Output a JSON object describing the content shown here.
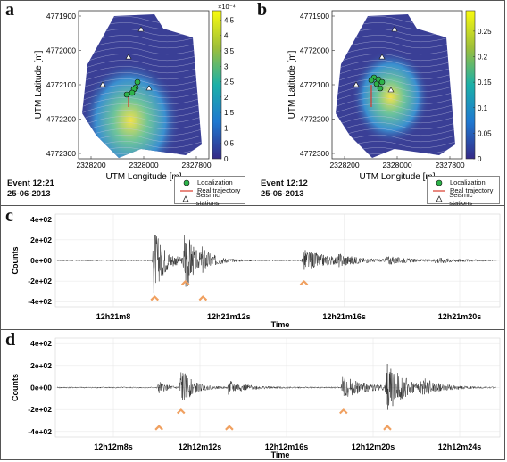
{
  "panels": [
    {
      "letter": "a",
      "event_line1": "Event 12:21",
      "event_line2": "25-06-2013",
      "y_ticks": [
        "4771900",
        "4772000",
        "4772100",
        "4772200",
        "4772300"
      ],
      "x_ticks": [
        "2328200",
        "2328000",
        "2327800"
      ],
      "ylabel": "UTM Latitude [m]",
      "xlabel": "UTM Longitude [m]",
      "colorbar": {
        "exponent": "×10⁻⁴",
        "ticks": [
          "4.5",
          "4",
          "3.5",
          "3",
          "2.5",
          "2",
          "1.5",
          "1",
          "0.5",
          "0"
        ],
        "max": 4.8
      },
      "legend": [
        "Localization",
        "Real trajectory",
        "Seismic stations"
      ]
    },
    {
      "letter": "b",
      "event_line1": "Event 12:12",
      "event_line2": "25-06-2013",
      "y_ticks": [
        "4771900",
        "4772000",
        "4772100",
        "4772200",
        "4772300"
      ],
      "x_ticks": [
        "2328200",
        "2328000",
        "2327800"
      ],
      "ylabel": "UTM Latitude [m]",
      "xlabel": "UTM Longitude [m]",
      "colorbar": {
        "exponent": "",
        "ticks": [
          "0.25",
          "0.2",
          "0.15",
          "0.1",
          "0.05",
          "0"
        ],
        "max": 0.29
      },
      "legend": [
        "Localization",
        "Real trajectory",
        "Seismic stations"
      ]
    }
  ],
  "chart_data": [
    {
      "type": "line",
      "panel": "c",
      "ylabel": "Counts",
      "xlabel": "Time",
      "y_ticks": [
        "4e+02",
        "2e+02",
        "0e+00",
        "-2e+02",
        "-4e+02"
      ],
      "x_ticks": [
        "12h21m8",
        "12h21m12s",
        "12h21m16s",
        "12h21m20s"
      ],
      "arrows": 4,
      "bursts": [
        {
          "center": 0.22,
          "amp": 330,
          "width": 0.025
        },
        {
          "center": 0.29,
          "amp": 360,
          "width": 0.02
        },
        {
          "center": 0.33,
          "amp": 90,
          "width": 0.03
        },
        {
          "center": 0.56,
          "amp": 110,
          "width": 0.06
        },
        {
          "center": 0.64,
          "amp": 40,
          "width": 0.04
        },
        {
          "center": 0.75,
          "amp": 35,
          "width": 0.05
        },
        {
          "center": 0.86,
          "amp": 25,
          "width": 0.05
        }
      ]
    },
    {
      "type": "line",
      "panel": "d",
      "ylabel": "Counts",
      "xlabel": "Time",
      "y_ticks": [
        "4e+02",
        "2e+02",
        "0e+00",
        "-2e+02",
        "-4e+02"
      ],
      "x_ticks": [
        "12h12m8s",
        "12h12m12s",
        "12h12m16s",
        "12h12m20s",
        "12h12m24s"
      ],
      "arrows": 5,
      "bursts": [
        {
          "center": 0.23,
          "amp": 60,
          "width": 0.02
        },
        {
          "center": 0.28,
          "amp": 190,
          "width": 0.025
        },
        {
          "center": 0.39,
          "amp": 60,
          "width": 0.04
        },
        {
          "center": 0.65,
          "amp": 110,
          "width": 0.05
        },
        {
          "center": 0.75,
          "amp": 230,
          "width": 0.04
        },
        {
          "center": 0.83,
          "amp": 60,
          "width": 0.04
        }
      ]
    }
  ],
  "colors": {
    "map_bg": "#3a3f96",
    "contour": "#c8cbe6",
    "hot": "#f2e24a",
    "warm": "#6ec49a",
    "marker_green": "#2db34a",
    "trajectory": "#d83a2a",
    "arrow": "#f0a060",
    "trace": "#222222"
  }
}
